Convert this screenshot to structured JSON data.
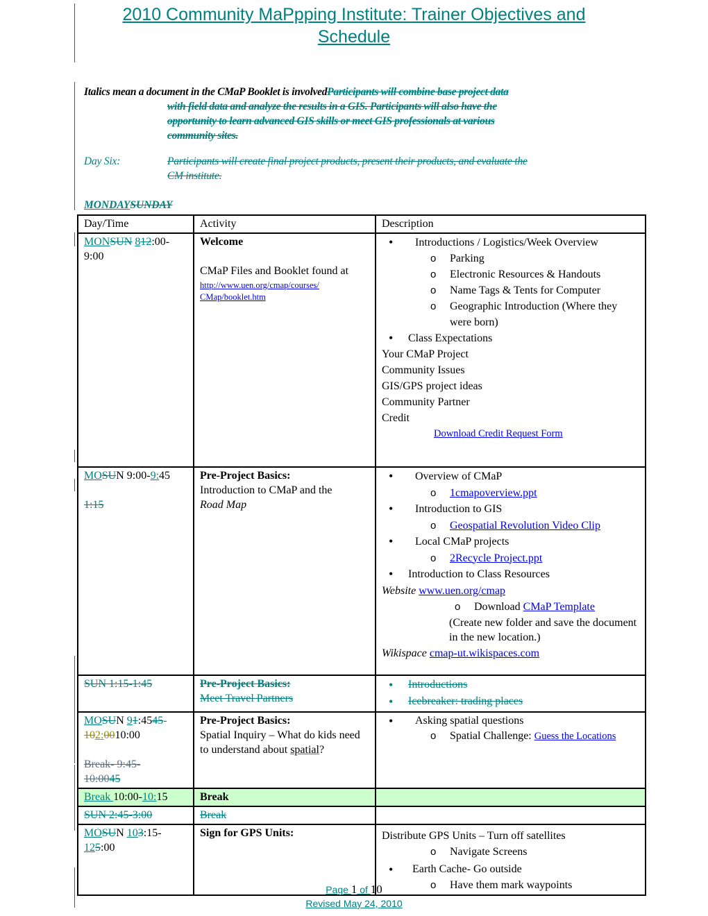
{
  "header": {
    "title": "2010 Community MaPpping Institute: Trainer Objectives and Schedule"
  },
  "intro": {
    "note": "Italics mean a document in the CMaP Booklet is involved",
    "deleted_text_1": "Participants will combine base project data",
    "deleted_text_2": "with field data and analyze the results in a GIS.  Participants will also have the",
    "deleted_text_3": "opportunity to learn advanced GIS skills or meet GIS professionals at various",
    "deleted_text_4": "community sites.",
    "day_six_label": "Day Six:",
    "day_six_text_1": "Participants will create final project products, present their products, and evaluate the",
    "day_six_text_2": "CM institute."
  },
  "day_heading": {
    "inserted": "MONDAY",
    "deleted": "SUNDAY"
  },
  "table": {
    "headers": [
      "Day/Time",
      "Activity",
      "Description"
    ],
    "row1": {
      "time_ins1": "MON",
      "time_del1": "SUN",
      "time_ins2": "8",
      "time_del2": "12",
      "time_rest": ":00-",
      "time_line2": "9:00",
      "activity_title": "Welcome",
      "activity_text": "CMaP Files and Booklet found at",
      "activity_link_1": "http://www.uen.org/cmap/courses/",
      "activity_link_2": "CMap/booklet.htm",
      "bullet1": "Introductions / Logistics/Week Overview",
      "sub": [
        "Parking",
        "Electronic Resources & Handouts",
        "Name Tags & Tents for Computer",
        "Geographic Introduction (Where they were born)"
      ],
      "bullet2": "Class Expectations",
      "plain": [
        "Your CMaP Project",
        "Community Issues",
        "GIS/GPS project ideas",
        "Community Partner",
        "Credit"
      ],
      "credit_link": "Download Credit Request Form"
    },
    "row2": {
      "time_ins1": "MO",
      "time_del1": "SU",
      "time_mid": "N 9:00-",
      "time_ins2": "9:",
      "time_rest": "45",
      "time_deleted_line": "1:15",
      "activity_title": "Pre-Project Basics:",
      "activity_text": "Introduction to CMaP and the",
      "activity_italic": "Road Map",
      "b1": "Overview of CMaP",
      "b1_link": "1cmapoverview.ppt",
      "b2": "Introduction to GIS",
      "b2_link": "Geospatial Revolution Video Clip",
      "b3": "Local CMaP projects",
      "b3_link": "2Recycle Project.ppt",
      "b4": "Introduction to Class Resources",
      "website_label": "Website",
      "website_link": "www.uen.org/cmap",
      "download_label": "Download",
      "download_link": "CMaP Template",
      "download_note": "(Create new folder and save the document in the new location.)",
      "wiki_label": "Wikispace",
      "wiki_link": "cmap-ut.wikispaces.com"
    },
    "row3": {
      "time": "SUN 1:15-1:45",
      "activity_title": "Pre-Project Basics:",
      "activity_text": "Meet Travel Partners",
      "b1": "Introductions",
      "b2": "Icebreaker: trading places"
    },
    "row4": {
      "time_ins1": "MO",
      "time_del1": "SU",
      "time_n": "N ",
      "time_ins2": "9",
      "time_del2": "1",
      "time_a": ":45",
      "time_del3": "45",
      "time_dash": "-",
      "time_olive_del1": "10",
      "time_olive_del2": "2:",
      "time_olive_del3": "00",
      "time_end": "10:00",
      "break_deleted_1": "Break- 9:45-",
      "break_deleted_2": "10:00",
      "break_deleted_3": "45",
      "activity_title": "Pre-Project Basics:",
      "activity_text": "Spatial Inquiry – What do kids need to understand about",
      "activity_link": "spatial",
      "activity_end": "?",
      "b1": "Asking spatial questions",
      "sub_label": "Spatial Challenge:",
      "sub_link": "Guess the Locations"
    },
    "row5": {
      "time_ins": "Break ",
      "time_mid": "10:00-",
      "time_ins2": "10:",
      "time_end": "15",
      "activity": "Break",
      "highlight_color": "#ccffcc"
    },
    "row6": {
      "time": "SUN 2:45-3:00",
      "activity": "Break"
    },
    "row7": {
      "time_ins1": "MO",
      "time_del1": "SU",
      "time_n": "N ",
      "time_ins2": "10",
      "time_del2": "3",
      "time_a": ":15-",
      "time_ins3": "12",
      "time_del3": "5",
      "time_end": ":00",
      "activity_title": "Sign for GPS Units:",
      "desc_line": "Distribute GPS Units – Turn off satellites",
      "sub1": "Navigate Screens",
      "b1": "Earth Cache- Go outside",
      "sub2": "Have them mark waypoints"
    }
  },
  "footer": {
    "page_label": "Page ",
    "page_number": "1",
    "of_label": " of ",
    "page_total": "10",
    "revised": "Revised May 24, 2010"
  },
  "colors": {
    "revision_teal": "#008080",
    "revision_olive": "#9a8a00",
    "link_blue": "#0000ee",
    "break_row": "#ccffcc"
  }
}
